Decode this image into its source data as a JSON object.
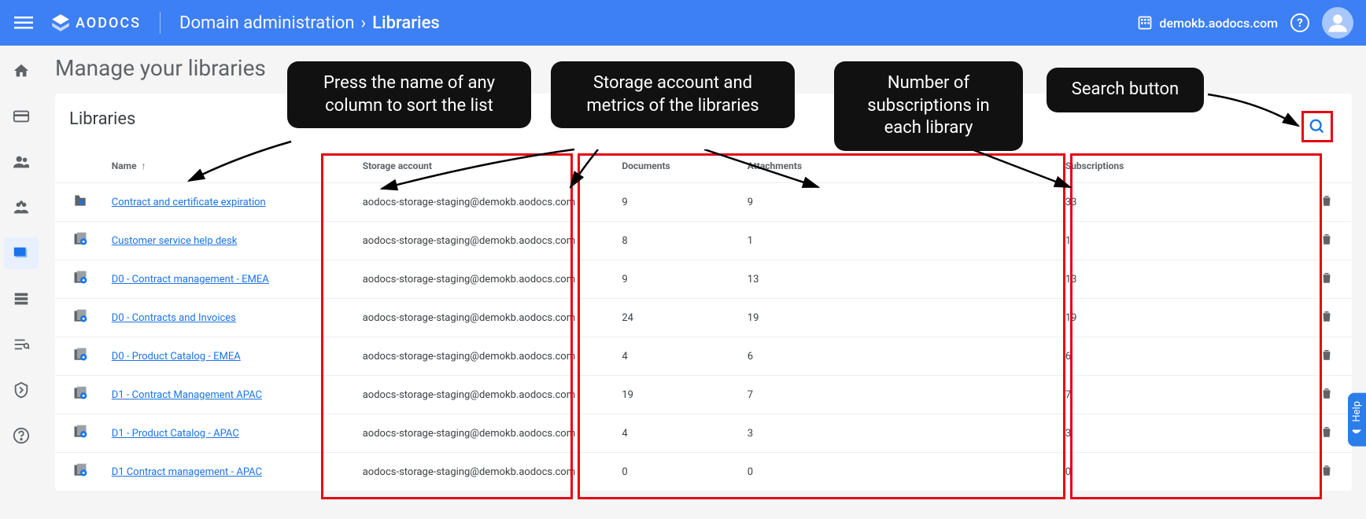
{
  "brand": "AODOCS",
  "breadcrumb": {
    "parent": "Domain administration",
    "current": "Libraries"
  },
  "domain_label": "demokb.aodocs.com",
  "page_title": "Manage your libraries",
  "section_title": "Libraries",
  "help_tab": "Help",
  "columns": {
    "name": "Name",
    "storage": "Storage account",
    "documents": "Documents",
    "attachments": "Attachments",
    "subscriptions": "Subscriptions"
  },
  "callouts": {
    "sort": "Press the name of any column to sort the list",
    "storage": "Storage account and metrics of the libraries",
    "subs": "Number of subscriptions in each library",
    "search": "Search button"
  },
  "rows": [
    {
      "icon": "secure",
      "name": "Contract and certificate expiration",
      "storage": "aodocs-storage-staging@demokb.aodocs.com",
      "documents": "9",
      "attachments": "9",
      "subscriptions": "33"
    },
    {
      "icon": "doc",
      "name": "Customer service help desk",
      "storage": "aodocs-storage-staging@demokb.aodocs.com",
      "documents": "8",
      "attachments": "1",
      "subscriptions": "1"
    },
    {
      "icon": "doc",
      "name": "D0 - Contract management - EMEA",
      "storage": "aodocs-storage-staging@demokb.aodocs.com",
      "documents": "9",
      "attachments": "13",
      "subscriptions": "13"
    },
    {
      "icon": "doc",
      "name": "D0 - Contracts and Invoices",
      "storage": "aodocs-storage-staging@demokb.aodocs.com",
      "documents": "24",
      "attachments": "19",
      "subscriptions": "19"
    },
    {
      "icon": "doc",
      "name": "D0 - Product Catalog - EMEA",
      "storage": "aodocs-storage-staging@demokb.aodocs.com",
      "documents": "4",
      "attachments": "6",
      "subscriptions": "6"
    },
    {
      "icon": "doc",
      "name": "D1 - Contract Management APAC",
      "storage": "aodocs-storage-staging@demokb.aodocs.com",
      "documents": "19",
      "attachments": "7",
      "subscriptions": "7"
    },
    {
      "icon": "doc",
      "name": "D1 - Product Catalog - APAC",
      "storage": "aodocs-storage-staging@demokb.aodocs.com",
      "documents": "4",
      "attachments": "3",
      "subscriptions": "3"
    },
    {
      "icon": "doc",
      "name": "D1 Contract management - APAC",
      "storage": "aodocs-storage-staging@demokb.aodocs.com",
      "documents": "0",
      "attachments": "0",
      "subscriptions": "0"
    }
  ]
}
